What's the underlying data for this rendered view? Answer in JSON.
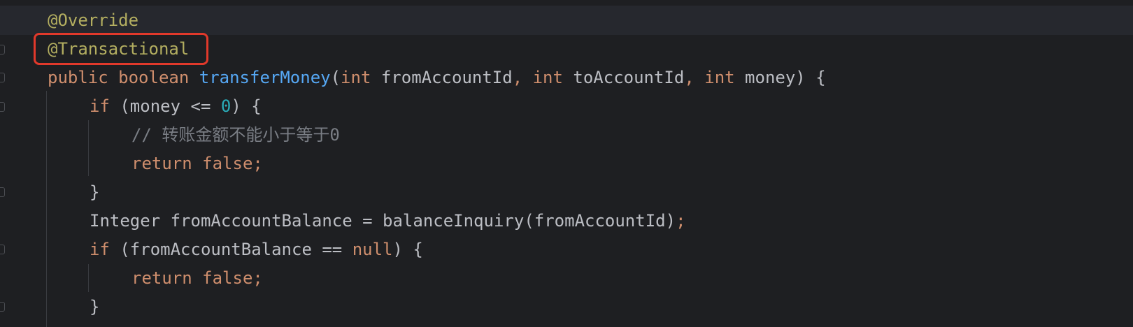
{
  "code": {
    "lines": [
      {
        "tokens": [
          {
            "t": "@Override",
            "c": "ann"
          }
        ]
      },
      {
        "tokens": [
          {
            "t": "@Transactional",
            "c": "ann"
          }
        ]
      },
      {
        "tokens": [
          {
            "t": "public ",
            "c": "kw"
          },
          {
            "t": "boolean ",
            "c": "kw"
          },
          {
            "t": "transferMoney",
            "c": "fn"
          },
          {
            "t": "(",
            "c": "plain"
          },
          {
            "t": "int ",
            "c": "kw"
          },
          {
            "t": "fromAccountId",
            "c": "plain"
          },
          {
            "t": ", ",
            "c": "kw"
          },
          {
            "t": "int ",
            "c": "kw"
          },
          {
            "t": "toAccountId",
            "c": "plain"
          },
          {
            "t": ", ",
            "c": "kw"
          },
          {
            "t": "int ",
            "c": "kw"
          },
          {
            "t": "money",
            "c": "plain"
          },
          {
            "t": ") {",
            "c": "plain"
          }
        ]
      },
      {
        "tokens": [
          {
            "t": "if ",
            "c": "kw"
          },
          {
            "t": "(money <= ",
            "c": "plain"
          },
          {
            "t": "0",
            "c": "num"
          },
          {
            "t": ") {",
            "c": "plain"
          }
        ]
      },
      {
        "tokens": [
          {
            "t": "// 转账金额不能小于等于0",
            "c": "cm"
          }
        ]
      },
      {
        "tokens": [
          {
            "t": "return false;",
            "c": "kw"
          }
        ]
      },
      {
        "tokens": [
          {
            "t": "}",
            "c": "plain"
          }
        ]
      },
      {
        "tokens": [
          {
            "t": "Integer ",
            "c": "plain"
          },
          {
            "t": "fromAccountBalance = balanceInquiry(fromAccountId)",
            "c": "plain"
          },
          {
            "t": ";",
            "c": "kw"
          }
        ]
      },
      {
        "tokens": [
          {
            "t": "if ",
            "c": "kw"
          },
          {
            "t": "(fromAccountBalance == ",
            "c": "plain"
          },
          {
            "t": "null",
            "c": "kw"
          },
          {
            "t": ") {",
            "c": "plain"
          }
        ]
      },
      {
        "tokens": [
          {
            "t": "return false;",
            "c": "kw"
          }
        ]
      },
      {
        "tokens": [
          {
            "t": "}",
            "c": "plain"
          }
        ]
      }
    ]
  },
  "colors": {
    "background": "#1e1f22",
    "keyword": "#cf8e6d",
    "annotation": "#b3ae60",
    "function": "#56a8f5",
    "number": "#2aacb8",
    "comment": "#7a7e85",
    "text": "#bcbec4",
    "highlight_box": "#e1392b"
  }
}
